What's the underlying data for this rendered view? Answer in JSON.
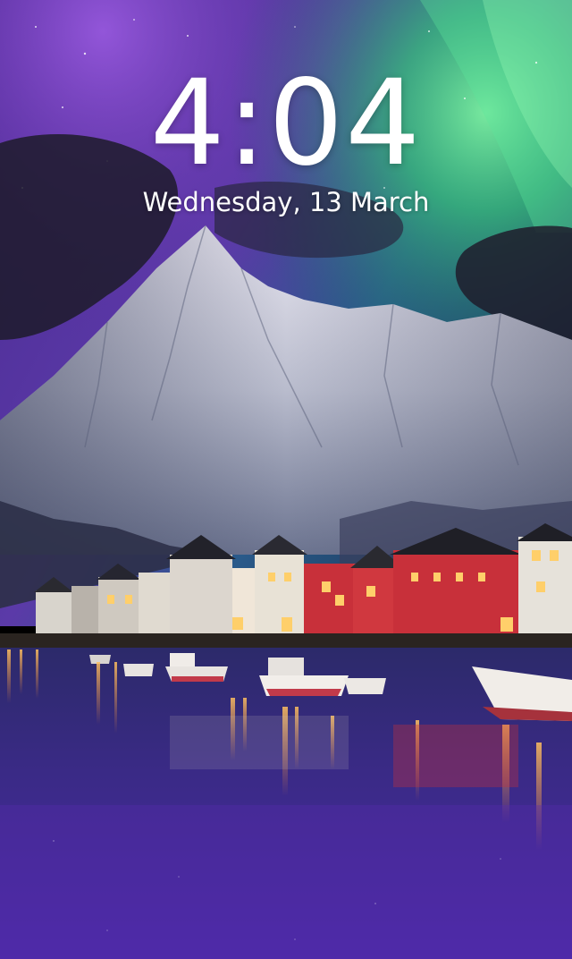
{
  "lockscreen": {
    "time": "4:04",
    "date": "Wednesday, 13 March"
  },
  "wallpaper": {
    "icon": "aurora-mountain-harbor-wallpaper",
    "colors": {
      "sky_top": "#3b1e7a",
      "aurora_green": "#3fd37a",
      "aurora_purple": "#7a3fc8",
      "snow": "#e6e8ee",
      "water": "#2a2270",
      "lights": "#ffb347",
      "house_red": "#c8303a"
    }
  }
}
